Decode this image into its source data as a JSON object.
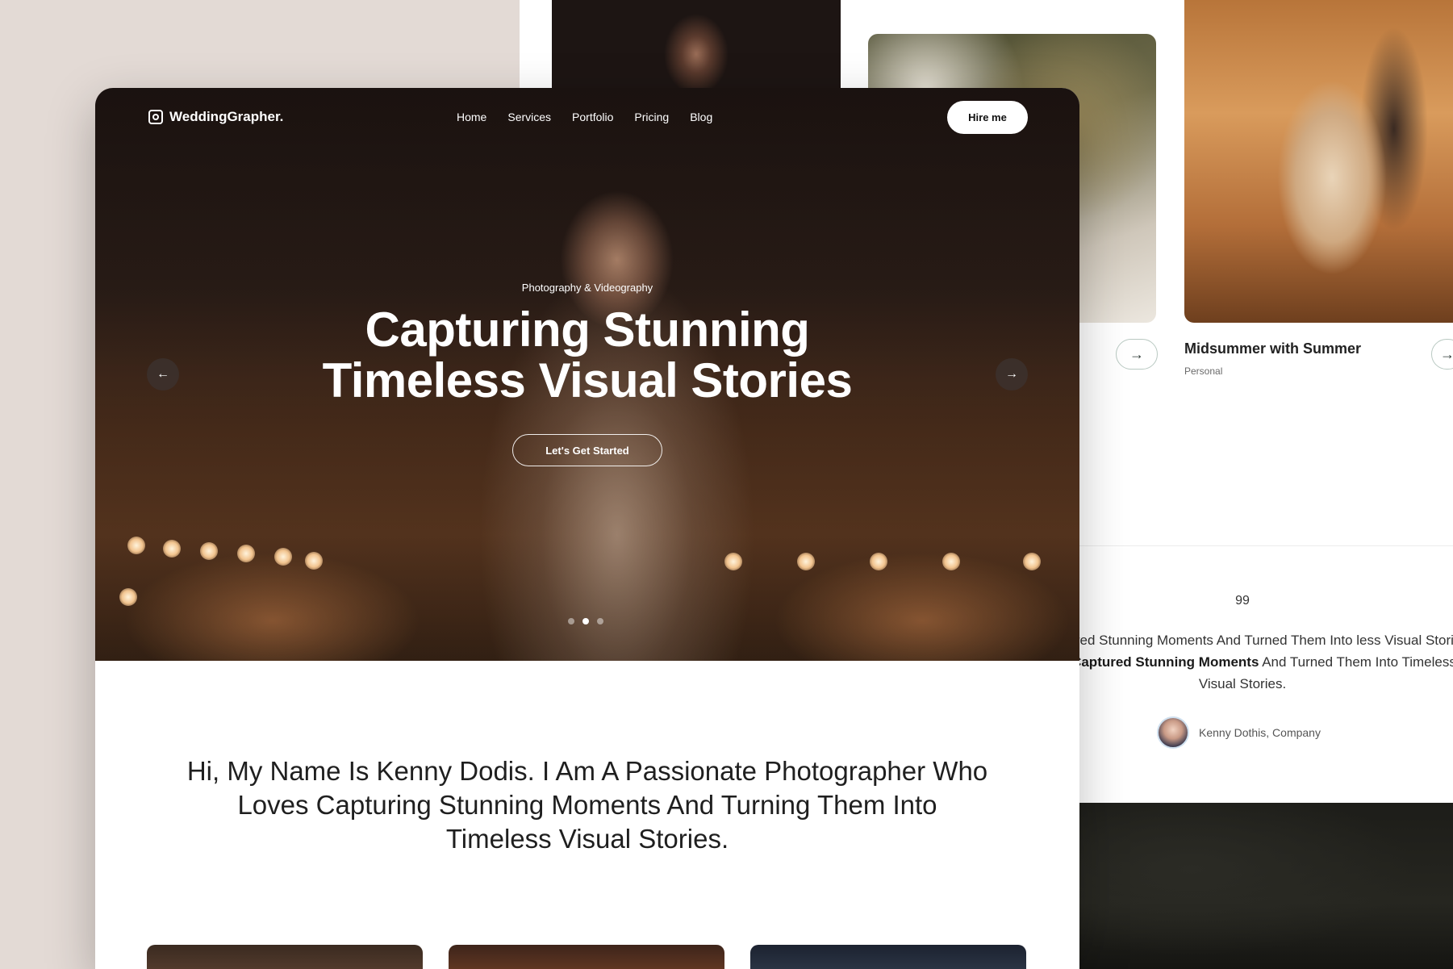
{
  "brand": {
    "name": "WeddingGrapher."
  },
  "nav": {
    "items": [
      "Home",
      "Services",
      "Portfolio",
      "Pricing",
      "Blog"
    ],
    "cta_label": "Hire me"
  },
  "hero": {
    "kicker": "Photography & Videography",
    "title": "Capturing Stunning Timeless Visual Stories",
    "cta_label": "Let's Get Started",
    "slide_count": 3,
    "active_slide": 2
  },
  "intro": {
    "text": "Hi, My Name Is Kenny Dodis. I Am A Passionate Photographer Who Loves Capturing Stunning Moments And Turning Them Into Timeless Visual Stories."
  },
  "portfolio_card": {
    "title": "Midsummer with Summer",
    "category": "Personal"
  },
  "testimonial": {
    "quote_mark": "99",
    "text_part1": "nny Captured Stunning Moments And Turned Them Into less Visual Stories. Kenny ",
    "text_bold": "Captured Stunning Moments",
    "text_part2": " And Turned Them Into Timeless Visual Stories.",
    "author": "Kenny Dothis, Company"
  },
  "icons": {
    "logo": "camera-frame-icon",
    "prev": "arrow-left-icon",
    "next": "arrow-right-icon"
  }
}
